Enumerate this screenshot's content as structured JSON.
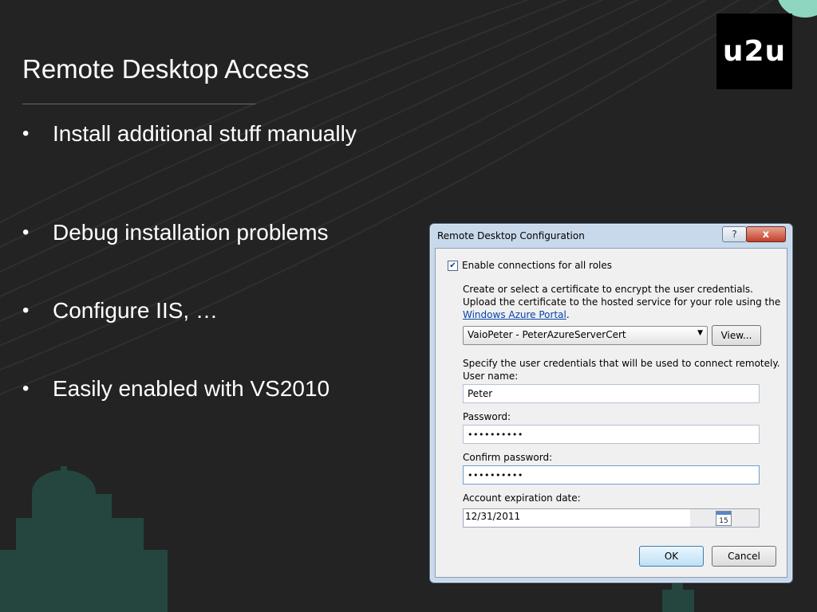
{
  "slide": {
    "title": "Remote Desktop Access",
    "logo_text": "u2u",
    "bullets": [
      "Install additional stuff manually",
      "Debug installation problems",
      "Configure IIS, …",
      "Easily enabled with VS2010"
    ],
    "bullet_symbol": "•"
  },
  "dialog": {
    "title": "Remote Desktop Configuration",
    "help_label": "?",
    "close_label": "x",
    "enable_checkbox": {
      "label": "Enable connections for all roles",
      "checked": true
    },
    "cert_text_line1": "Create or select a certificate to encrypt the user credentials.",
    "cert_text_line2": "Upload the certificate to the hosted service for your role using the",
    "portal_link": "Windows Azure Portal",
    "portal_link_suffix": ".",
    "certificate_selected": "VaioPeter - PeterAzureServerCert",
    "view_button": "View...",
    "credentials_text": "Specify the user credentials that will be used to connect remotely.",
    "username_label": "User name:",
    "username_value": "Peter",
    "password_label": "Password:",
    "password_value": "••••••••••",
    "confirm_label": "Confirm password:",
    "confirm_value": "••••••••••",
    "expiration_label": "Account expiration date:",
    "expiration_value": "12/31/2011",
    "calendar_day": "15",
    "ok_button": "OK",
    "cancel_button": "Cancel"
  },
  "colors": {
    "background": "#232323",
    "accent": "#8fd6c0",
    "link": "#0645ad"
  }
}
